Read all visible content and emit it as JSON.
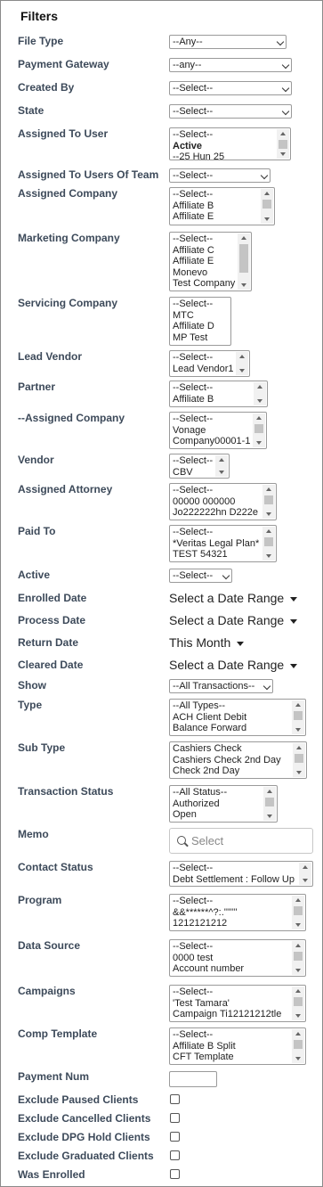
{
  "filters_title": "Filters",
  "file_type": {
    "label": "File Type",
    "value": "--Any--"
  },
  "payment_gateway": {
    "label": "Payment Gateway",
    "value": "--any--"
  },
  "created_by": {
    "label": "Created By",
    "value": "--Select--"
  },
  "state": {
    "label": "State",
    "value": "--Select--"
  },
  "assigned_to_user": {
    "label": "Assigned To User",
    "options": [
      "--Select--",
      "Active",
      "--25 Hun 25"
    ]
  },
  "assigned_to_users_of_team": {
    "label": "Assigned To Users Of Team",
    "value": "--Select--"
  },
  "assigned_company": {
    "label": "Assigned Company",
    "options": [
      "--Select--",
      "Affiliate B",
      "Affiliate E"
    ]
  },
  "marketing_company": {
    "label": "Marketing Company",
    "options": [
      "--Select--",
      "Affiliate C",
      "Affiliate E",
      "Monevo",
      "Test Company"
    ]
  },
  "servicing_company": {
    "label": "Servicing Company",
    "options": [
      "--Select--",
      "MTC",
      "Affiliate D",
      "MP Test"
    ]
  },
  "lead_vendor": {
    "label": "Lead Vendor",
    "options": [
      "--Select--",
      "Lead Vendor1"
    ]
  },
  "partner": {
    "label": "Partner",
    "options": [
      "--Select--",
      "Affiliate B"
    ]
  },
  "assigned_company_2": {
    "label": "--Assigned Company",
    "options": [
      "--Select--",
      "Vonage",
      "Company00001-1"
    ]
  },
  "vendor": {
    "label": "Vendor",
    "options": [
      "--Select--",
      "CBV"
    ]
  },
  "assigned_attorney": {
    "label": "Assigned Attorney",
    "options": [
      "--Select--",
      "00000 000000",
      "Jo222222hn D222e"
    ]
  },
  "paid_to": {
    "label": "Paid To",
    "options": [
      "--Select--",
      "*Veritas Legal Plan*",
      "TEST 54321"
    ]
  },
  "active": {
    "label": "Active",
    "value": "--Select--"
  },
  "enrolled_date": {
    "label": "Enrolled Date",
    "value": "Select a Date Range"
  },
  "process_date": {
    "label": "Process Date",
    "value": "Select a Date Range"
  },
  "return_date": {
    "label": "Return Date",
    "value": "This Month"
  },
  "cleared_date": {
    "label": "Cleared Date",
    "value": "Select a Date Range"
  },
  "show": {
    "label": "Show",
    "value": "--All Transactions--"
  },
  "type": {
    "label": "Type",
    "options": [
      "--All Types--",
      "ACH Client Debit",
      "Balance Forward"
    ]
  },
  "sub_type": {
    "label": "Sub Type",
    "options": [
      "Cashiers Check",
      "Cashiers Check 2nd Day",
      "Check 2nd Day"
    ]
  },
  "transaction_status": {
    "label": "Transaction Status",
    "options": [
      "--All Status--",
      "Authorized",
      "Open"
    ]
  },
  "memo": {
    "label": "Memo",
    "placeholder": "Select"
  },
  "contact_status": {
    "label": "Contact Status",
    "options": [
      "--Select--",
      "Debt Settlement : Follow Up"
    ]
  },
  "program": {
    "label": "Program",
    "options": [
      "--Select--",
      "&&******^?:.'''''''",
      "1212121212"
    ]
  },
  "data_source": {
    "label": "Data Source",
    "options": [
      "--Select--",
      "0000 test",
      "Account number"
    ]
  },
  "campaigns": {
    "label": "Campaigns",
    "options": [
      "--Select--",
      "'Test Tamara'",
      "Campaign Ti12121212tle"
    ]
  },
  "comp_template": {
    "label": "Comp Template",
    "options": [
      "--Select--",
      "Affiliate B Split",
      "CFT Template"
    ]
  },
  "payment_num": {
    "label": "Payment Num",
    "value": ""
  },
  "exclude_paused": {
    "label": "Exclude Paused Clients"
  },
  "exclude_cancelled": {
    "label": "Exclude Cancelled Clients"
  },
  "exclude_dpg_hold": {
    "label": "Exclude DPG Hold Clients"
  },
  "exclude_graduated": {
    "label": "Exclude Graduated Clients"
  },
  "was_enrolled": {
    "label": "Was Enrolled"
  }
}
